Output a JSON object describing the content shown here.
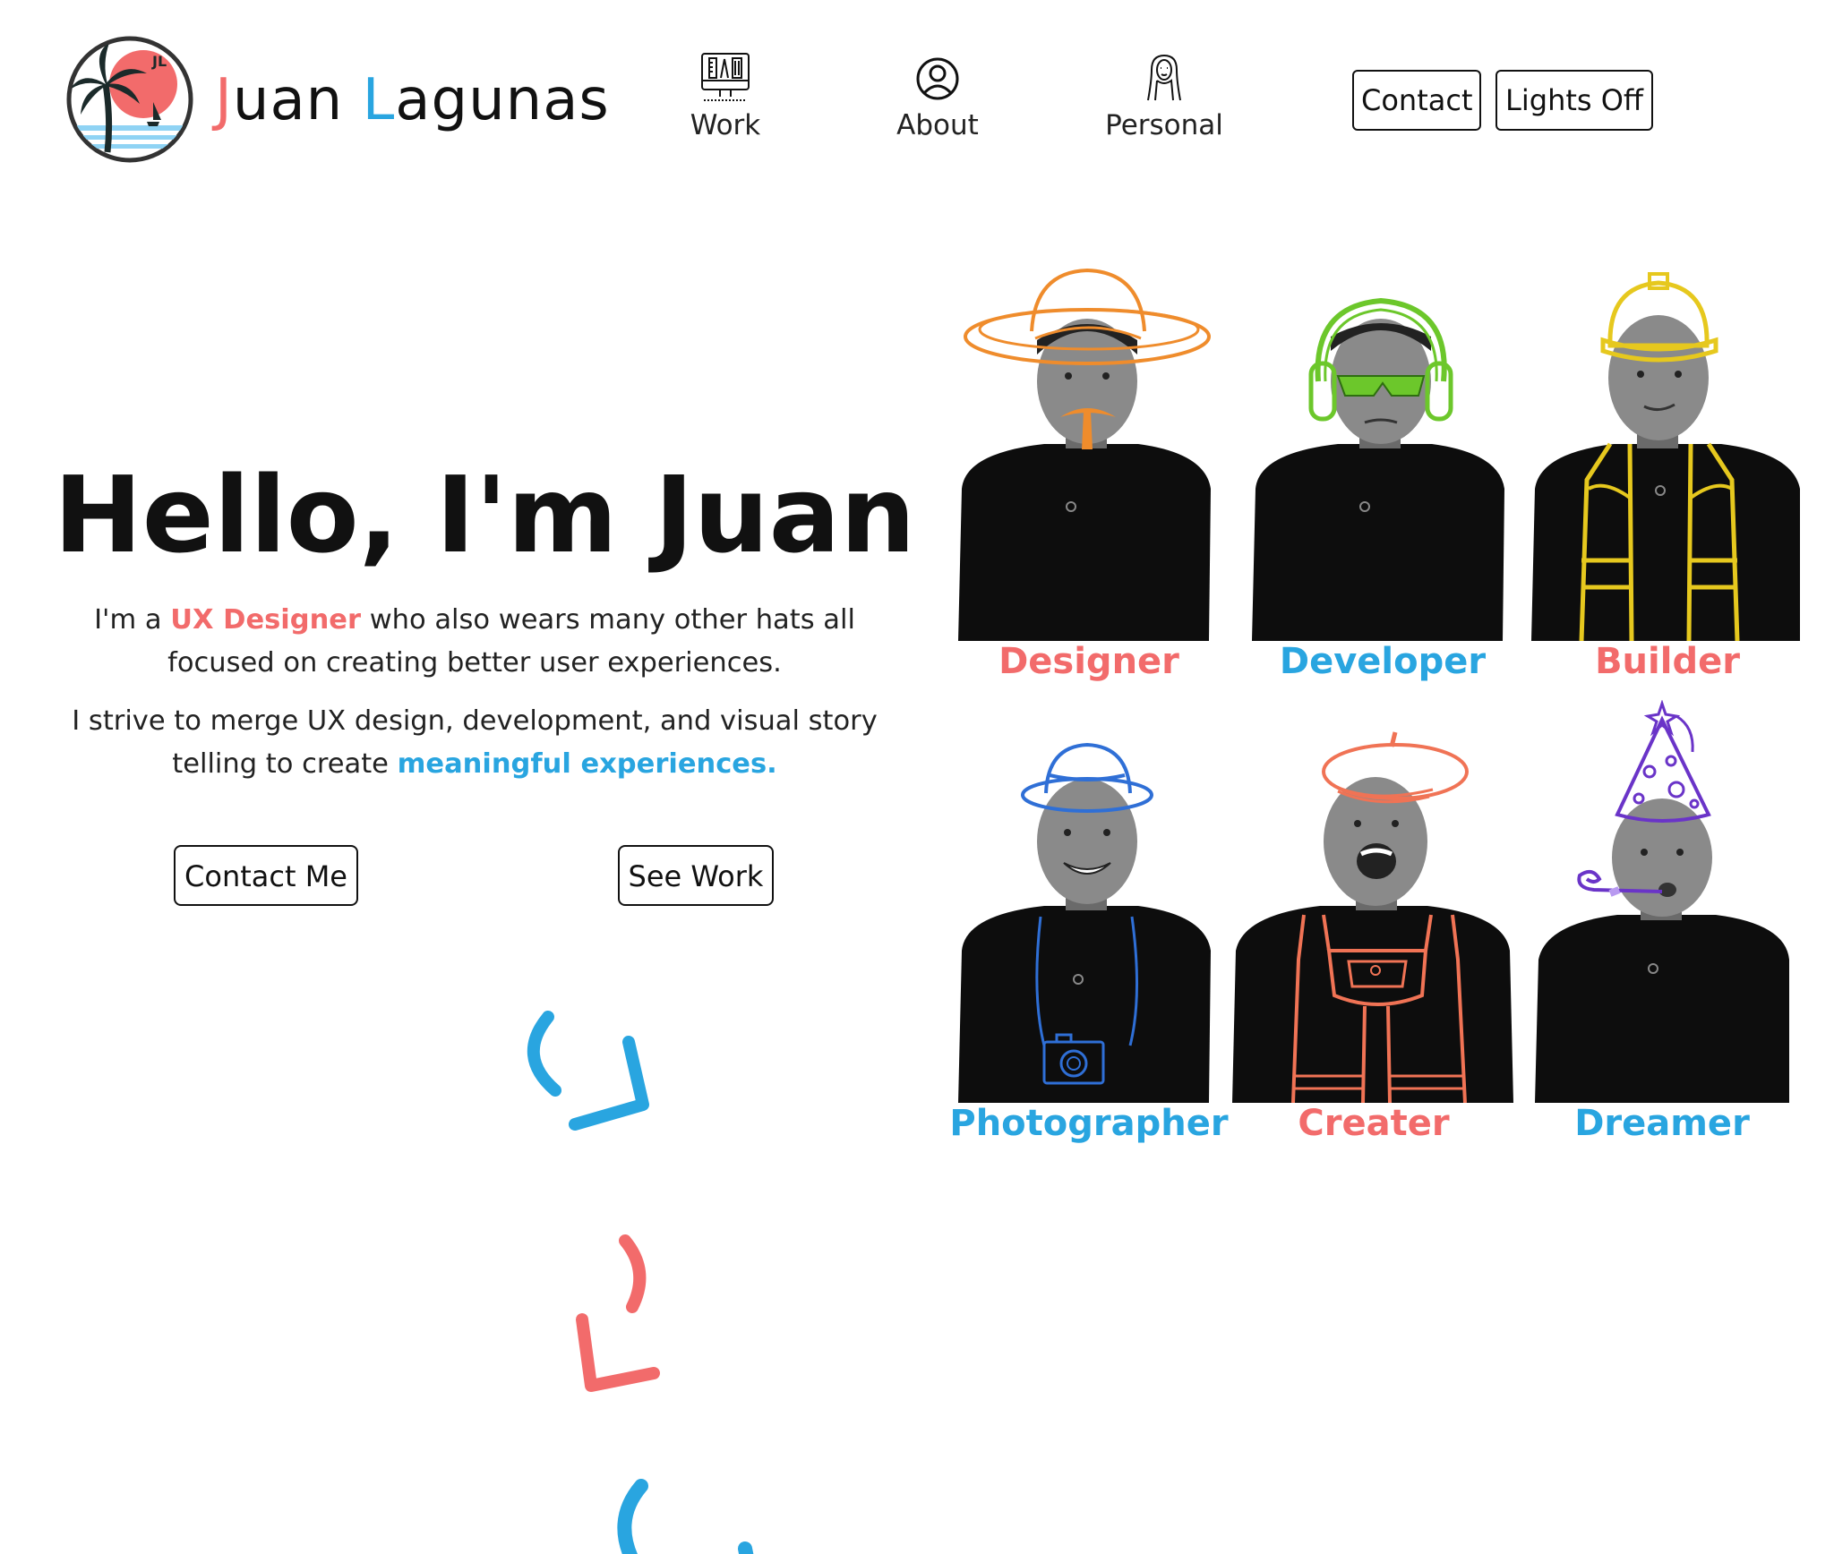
{
  "brand": {
    "first_initial": "J",
    "first_rest": "uan",
    "last_initial": "L",
    "last_rest": "agunas",
    "logo_monogram": "JL",
    "colors": {
      "red": "#f26b6b",
      "blue": "#29a5e0"
    }
  },
  "nav": {
    "items": [
      {
        "label": "Work",
        "icon": "design-tools-monitor-icon"
      },
      {
        "label": "About",
        "icon": "user-circle-icon"
      },
      {
        "label": "Personal",
        "icon": "mona-lisa-portrait-icon"
      }
    ],
    "contact_label": "Contact",
    "lights_label": "Lights Off"
  },
  "hero": {
    "title": "Hello, I'm Juan",
    "p1": {
      "prefix": "I'm a ",
      "highlight": "UX Designer",
      "suffix": " who also wears many other hats all focused on creating better user experiences."
    },
    "p2": {
      "prefix": "I strive to merge UX design, development, and visual story telling to create ",
      "highlight": "meaningful experiences."
    },
    "cta_contact": "Contact Me",
    "cta_work": "See Work"
  },
  "personas": [
    {
      "label": "Designer",
      "color": "#f26b6b",
      "accent": "#ef8c2c",
      "hat": "sombrero-mustache"
    },
    {
      "label": "Developer",
      "color": "#29a5e0",
      "accent": "#6cc72b",
      "hat": "headphones-sunglasses"
    },
    {
      "label": "Builder",
      "color": "#f26b6b",
      "accent": "#e6c81e",
      "hat": "hard-hat-safety-vest"
    },
    {
      "label": "Photographer",
      "color": "#29a5e0",
      "accent": "#2f6fd6",
      "hat": "fedora-camera"
    },
    {
      "label": "Creater",
      "color": "#f26b6b",
      "accent": "#f07355",
      "hat": "beret-overalls"
    },
    {
      "label": "Dreamer",
      "color": "#29a5e0",
      "accent": "#6a34c8",
      "hat": "party-hat-blower"
    }
  ]
}
